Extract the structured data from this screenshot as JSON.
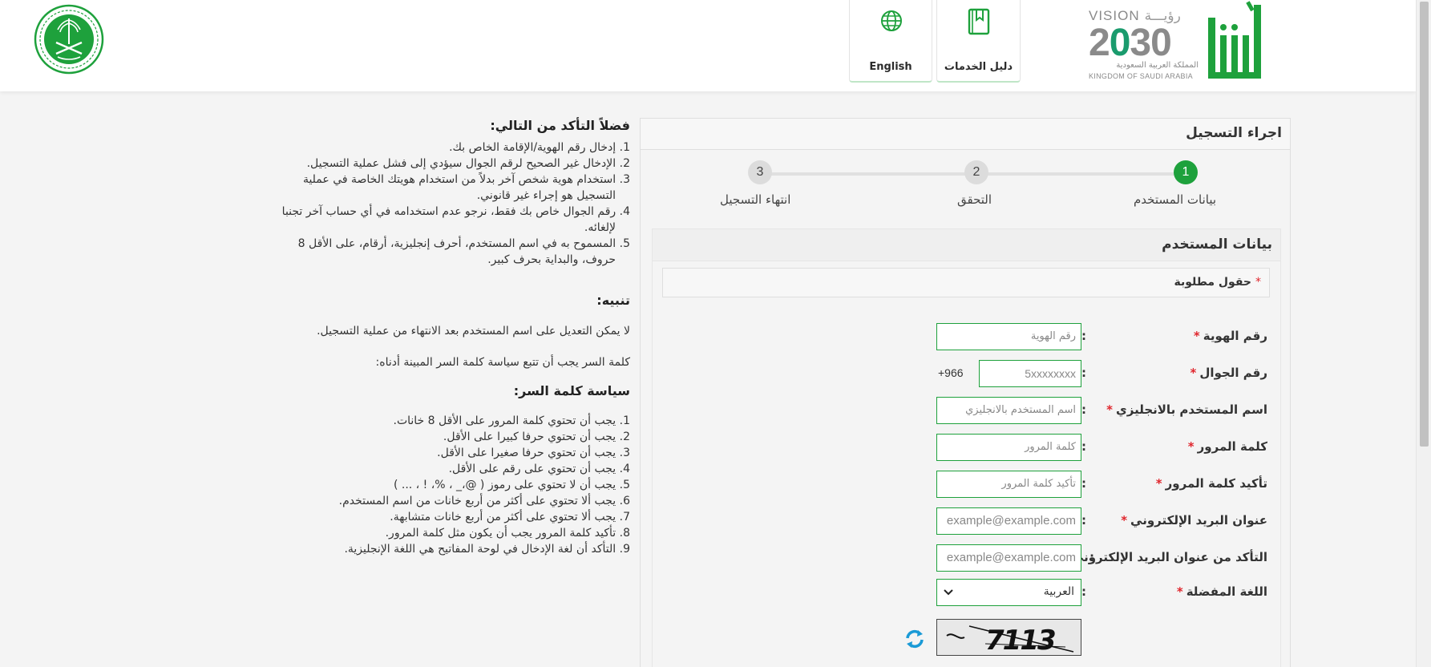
{
  "header": {
    "guide_label": "دليل الخدمات",
    "english_label": "English",
    "vision": {
      "vision_text": "VISION",
      "vision_ar": "رؤيـــة",
      "year": "2030",
      "kingdom_ar": "المملكة العربية السعودية",
      "kingdom_en": "KINGDOM OF SAUDI ARABIA"
    },
    "colors": {
      "brand_green": "#1ea13c",
      "vision_gray": "#8a8a8a"
    }
  },
  "panel": {
    "title": "اجراء التسجيل",
    "steps": [
      {
        "number": "1",
        "label": "بيانات المستخدم",
        "active": true
      },
      {
        "number": "2",
        "label": "التحقق",
        "active": false
      },
      {
        "number": "3",
        "label": "انتهاء التسجيل",
        "active": false
      }
    ],
    "section_title": "بيانات المستخدم",
    "required_star": "*",
    "required_note": "حقول مطلوبة",
    "fields": {
      "id": {
        "label": "رقم الهوية",
        "placeholder": "رقم الهوية"
      },
      "mobile": {
        "label": "رقم الجوال",
        "placeholder": "5xxxxxxxx",
        "prefix": "+966"
      },
      "username": {
        "label": "اسم المستخدم بالانجليزي",
        "placeholder": "اسم المستخدم بالانجليزي"
      },
      "password": {
        "label": "كلمة المرور",
        "placeholder": "كلمة المرور"
      },
      "confirm_password": {
        "label": "تأكيد كلمة المرور",
        "placeholder": "تأكيد كلمة المرور"
      },
      "email": {
        "label": "عنوان البريد الإلكتروني",
        "placeholder": "example@example.com"
      },
      "confirm_email": {
        "label": "التأكد من عنوان البريد الإلكتروني",
        "placeholder": "example@example.com"
      },
      "language": {
        "label": "اللغة المفضلة",
        "value": "العربية"
      }
    },
    "colon": ":",
    "captcha_text": "7113"
  },
  "instructions": {
    "check_title": "فضلاً التأكد من التالي:",
    "check_items": [
      "1. إدخال رقم الهوية/الإقامة الخاص بك.",
      "2. الإدخال غير الصحيح لرقم الجوال سيؤدي إلى فشل عملية التسجيل.",
      "3. استخدام هوية شخص آخر بدلاً من استخدام هويتك الخاصة في عملية",
      "التسجيل هو إجراء غير قانوني.",
      "4. رقم الجوال خاص بك فقط، نرجو عدم استخدامه في أي حساب آخر تجنبا",
      "لإلغائه.",
      "5. المسموح به في اسم المستخدم، أحرف إنجليزية، أرقام، على الأقل 8",
      "حروف، والبداية بحرف كبير."
    ],
    "warning_title": "تنبيه:",
    "warning_text": "لا يمكن التعديل على اسم المستخدم بعد الانتهاء من عملية التسجيل.",
    "policy_intro": "كلمة السر يجب أن تتبع سياسة كلمة السر المبينة أدناه:",
    "policy_title": "سياسة كلمة السر:",
    "policy_items": [
      "1. يجب أن تحتوي كلمة المرور على الأقل 8 خانات.",
      "2. يجب أن تحتوي حرفا كبيرا على الأقل.",
      "3. يجب أن تحتوي حرفا صغيرا على الأقل.",
      "4. يجب أن تحتوي على رقم على الأقل.",
      "5. يجب أن لا تحتوي على رموز ( @،_ ، %، ! ، ... )",
      "6. يجب ألا تحتوي على أكثر من أربع خانات من اسم المستخدم.",
      "7. يجب ألا تحتوي على أكثر من أربع خانات متشابهة.",
      "8. تأكيد كلمة المرور يجب أن يكون مثل كلمة المرور.",
      "9. التأكد أن لغة الإدخال في لوحة المفاتيح هي اللغة الإنجليزية."
    ]
  }
}
